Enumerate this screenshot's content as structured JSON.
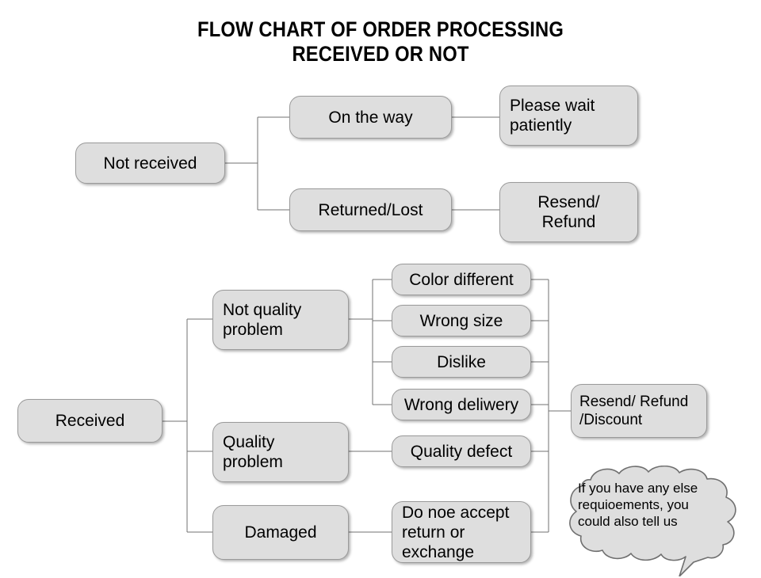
{
  "title": {
    "line1": "FLOW CHART OF ORDER PROCESSING",
    "line2": "RECEIVED OR NOT"
  },
  "colors": {
    "node_fill": "#dedede",
    "node_border": "#9a9a9a",
    "connector": "#707070",
    "text": "#000000",
    "background": "#ffffff"
  },
  "chart_data": {
    "type": "diagram",
    "title": "FLOW CHART OF ORDER PROCESSING RECEIVED OR NOT",
    "branches": [
      {
        "root": "Not received",
        "children": [
          {
            "label": "On the way",
            "outcome": "Please wait\npatiently"
          },
          {
            "label": "Returned/Lost",
            "outcome": "Resend/\nRefund"
          }
        ]
      },
      {
        "root": "Received",
        "children": [
          {
            "label": "Not quality\nproblem",
            "reasons": [
              "Color different",
              "Wrong size",
              "Dislike",
              "Wrong deliwery"
            ],
            "outcome": "Resend/ Refund\n/Discount"
          },
          {
            "label": "Quality\nproblem",
            "reasons": [
              "Quality defect"
            ],
            "outcome": "Resend/ Refund\n/Discount"
          },
          {
            "label": "Damaged",
            "reasons": [
              "Do noe accept\nreturn or\nexchange"
            ],
            "outcome": ""
          }
        ]
      }
    ],
    "note": "If you have any else\nrequioements, you\ncould also tell us"
  },
  "nodes": {
    "not_received": "Not received",
    "on_the_way": "On the way",
    "returned_lost": "Returned/Lost",
    "please_wait": "Please wait\npatiently",
    "resend_refund": "Resend/\nRefund",
    "received": "Received",
    "not_quality_problem": "Not quality\nproblem",
    "quality_problem": "Quality\nproblem",
    "damaged": "Damaged",
    "color_different": "Color different",
    "wrong_size": "Wrong size",
    "dislike": "Dislike",
    "wrong_deliwery": "Wrong deliwery",
    "quality_defect": "Quality defect",
    "do_not_accept": "Do noe accept\nreturn or\nexchange",
    "resend_refund_discount": "Resend/ Refund\n/Discount"
  },
  "bubble": {
    "text": "If you have any else\nrequioements, you\ncould also tell us"
  }
}
